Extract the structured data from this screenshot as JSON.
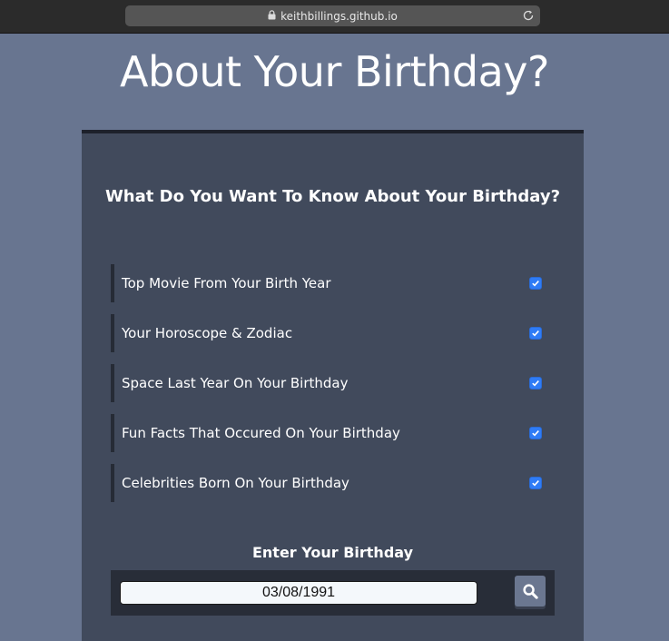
{
  "browser": {
    "url": "keithbillings.github.io"
  },
  "page": {
    "title": "About Your Birthday?"
  },
  "card": {
    "heading": "What Do You Want To Know About Your Birthday?",
    "options": [
      {
        "label": "Top Movie From Your Birth Year",
        "checked": true
      },
      {
        "label": "Your Horoscope & Zodiac",
        "checked": true
      },
      {
        "label": "Space Last Year On Your Birthday",
        "checked": true
      },
      {
        "label": "Fun Facts That Occured On Your Birthday",
        "checked": true
      },
      {
        "label": "Celebrities Born On Your Birthday",
        "checked": true
      }
    ],
    "birthday_label": "Enter Your Birthday",
    "birthday_value": "03/08/1991"
  },
  "icons": {
    "lock": "lock-icon",
    "reload": "reload-icon",
    "check": "checkmark-icon",
    "search": "search-icon"
  },
  "colors": {
    "background": "#687590",
    "card": "#414a5c",
    "checkbox": "#2f7cf6",
    "search_button": "#6b7790"
  }
}
